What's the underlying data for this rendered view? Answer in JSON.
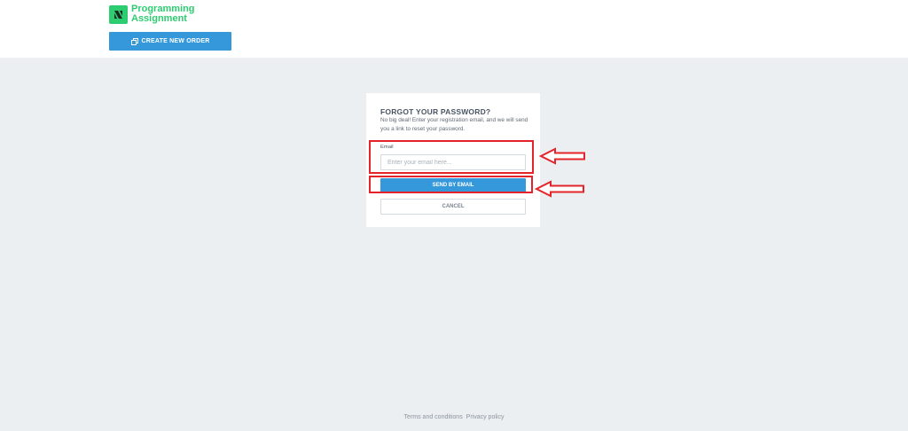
{
  "header": {
    "brand_line1": "Programming",
    "brand_line2": "Assignment",
    "create_order_label": "CREATE NEW ORDER",
    "brand_color": "#2ecc71",
    "accent_color": "#3498db"
  },
  "form": {
    "title": "FORGOT YOUR PASSWORD?",
    "subtitle": "No big deal! Enter your registration email, and we will send you a link to reset your password.",
    "email_label": "Email",
    "email_placeholder": "Enter your email here...",
    "email_value": "",
    "send_label": "SEND BY EMAIL",
    "cancel_label": "CANCEL"
  },
  "footer": {
    "terms_label": "Terms and conditions",
    "privacy_label": "Privacy policy"
  },
  "annotations": {
    "highlight_color": "#e3242b"
  }
}
